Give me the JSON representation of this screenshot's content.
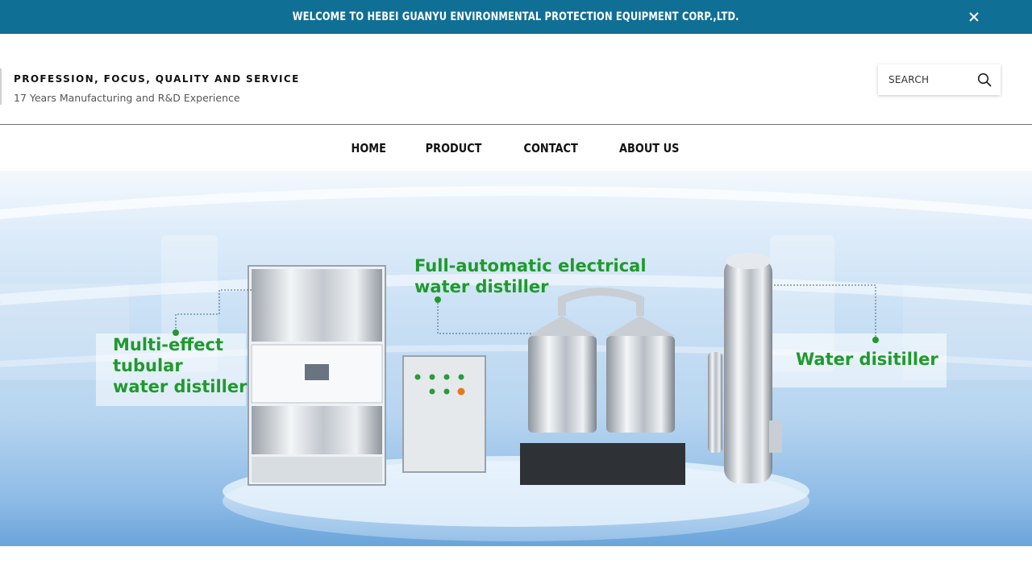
{
  "topbar": {
    "welcome": "WELCOME TO HEBEI GUANYU ENVIRONMENTAL PROTECTION EQUIPMENT CORP.,LTD.",
    "close_icon": "close-icon"
  },
  "header": {
    "slogan": "PROFESSION, FOCUS, QUALITY AND SERVICE",
    "subslogan": "17 Years Manufacturing and R&D Experience"
  },
  "search": {
    "placeholder": "SEARCH",
    "icon": "search-icon"
  },
  "nav": {
    "items": [
      {
        "label": "HOME"
      },
      {
        "label": "PRODUCT"
      },
      {
        "label": "CONTACT"
      },
      {
        "label": "ABOUT US"
      }
    ]
  },
  "banner": {
    "products": [
      {
        "line1": "Multi-effect",
        "line2": "tubular",
        "line3": "water distiller"
      },
      {
        "line1": "Full-automatic electrical",
        "line2": "water distiller"
      },
      {
        "line1": "Water disitiller"
      }
    ],
    "colors": {
      "label_green": "#1f9a2c",
      "topbar_blue": "#106f94"
    }
  }
}
